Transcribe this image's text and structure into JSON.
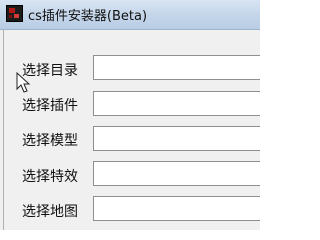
{
  "window": {
    "title": "cs插件安装器(Beta)"
  },
  "form": {
    "rows": [
      {
        "label": "选择目录",
        "value": ""
      },
      {
        "label": "选择插件",
        "value": ""
      },
      {
        "label": "选择模型",
        "value": ""
      },
      {
        "label": "选择特效",
        "value": ""
      },
      {
        "label": "选择地图",
        "value": ""
      }
    ]
  },
  "icons": {
    "app": "app-icon",
    "pointer": "mouse-pointer-icon"
  }
}
